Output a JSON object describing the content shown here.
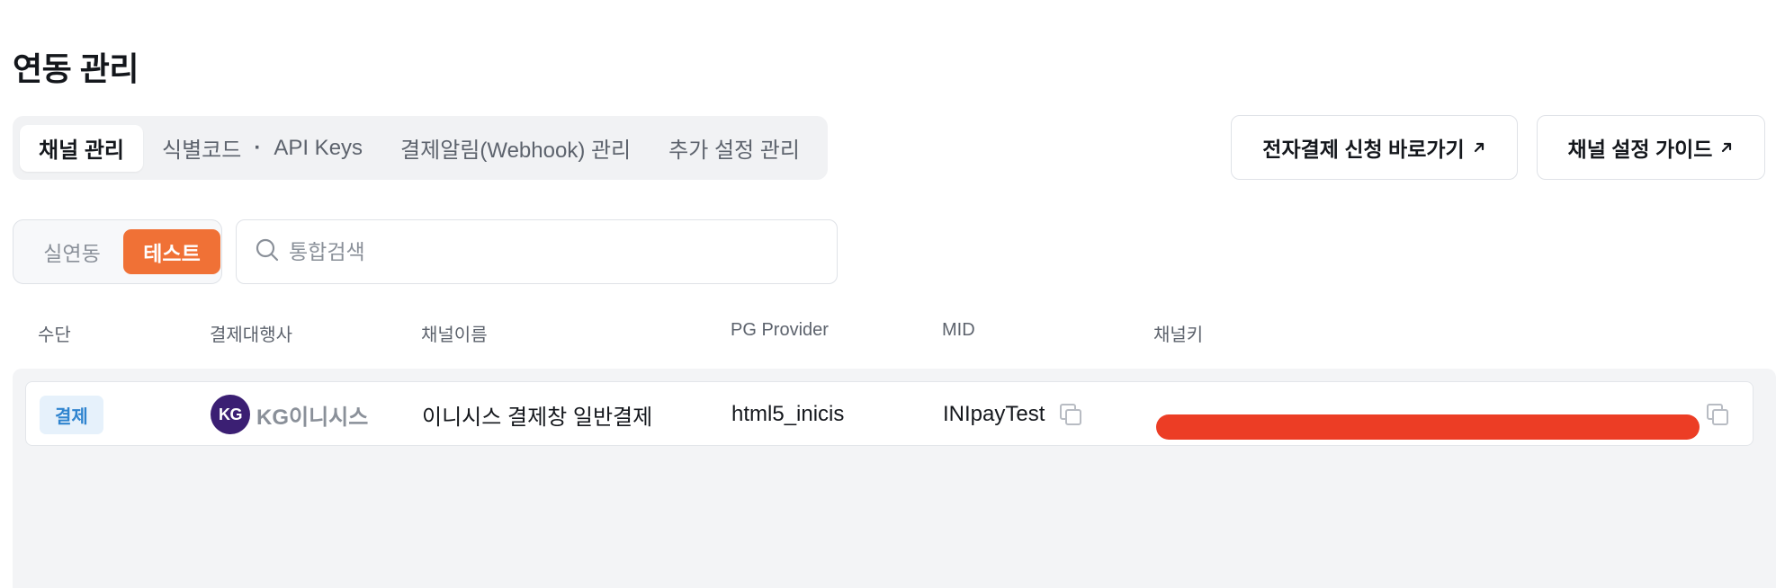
{
  "page": {
    "title": "연동 관리"
  },
  "tabs": [
    {
      "label": "채널 관리",
      "active": true
    },
    {
      "label_a": "식별코드",
      "sep": "·",
      "label_b": "API Keys",
      "active": false
    },
    {
      "label": "결제알림(Webhook) 관리",
      "active": false
    },
    {
      "label": "추가 설정 관리",
      "active": false
    }
  ],
  "header_buttons": {
    "apply": {
      "label": "전자결제 신청 바로가기",
      "icon": "external-arrow-icon"
    },
    "guide": {
      "label": "채널 설정 가이드",
      "icon": "external-arrow-icon"
    }
  },
  "mode_toggle": {
    "live_label": "실연동",
    "test_label": "테스트",
    "selected": "테스트",
    "accent": "#f07136"
  },
  "search": {
    "placeholder": "통합검색",
    "value": ""
  },
  "table": {
    "columns": [
      "수단",
      "결제대행사",
      "채널이름",
      "PG Provider",
      "MID",
      "채널키"
    ],
    "rows": [
      {
        "method": "결제",
        "pg_logo": "KG",
        "pg_name": "KG이니시스",
        "channel_name": "이니시스 결제창 일반결제",
        "pg_provider": "html5_inicis",
        "mid": "INIpayTest",
        "channel_key_redacted": true
      }
    ]
  },
  "colors": {
    "badge_bg": "#e6f1fb",
    "badge_text": "#2f84cf",
    "redaction": "#ec3d25",
    "pg_logo_bg": "#3b1f73"
  }
}
